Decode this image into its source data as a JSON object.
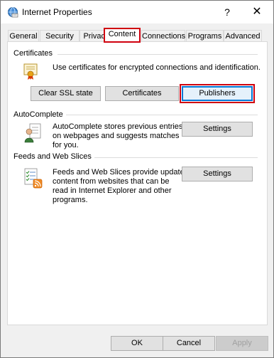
{
  "window": {
    "title": "Internet Properties",
    "help_glyph": "?",
    "close_glyph": "✕"
  },
  "tabs": [
    {
      "label": "General"
    },
    {
      "label": "Security"
    },
    {
      "label": "Privacy"
    },
    {
      "label": "Content",
      "active": true
    },
    {
      "label": "Connections"
    },
    {
      "label": "Programs"
    },
    {
      "label": "Advanced"
    }
  ],
  "certificates": {
    "group_label": "Certificates",
    "description": "Use certificates for encrypted connections and identification.",
    "buttons": {
      "clear_ssl": "Clear SSL state",
      "certificates": "Certificates",
      "publishers": "Publishers"
    }
  },
  "autocomplete": {
    "group_label": "AutoComplete",
    "description_lines": [
      "AutoComplete stores previous entries",
      "on webpages and suggests matches",
      "for you."
    ],
    "settings_label": "Settings"
  },
  "feeds": {
    "group_label": "Feeds and Web Slices",
    "description_lines": [
      "Feeds and Web Slices provide updated",
      "content from websites that can be",
      "read in Internet Explorer and other",
      "programs."
    ],
    "settings_label": "Settings"
  },
  "footer": {
    "ok": "OK",
    "cancel": "Cancel",
    "apply": "Apply"
  },
  "colors": {
    "highlight_red": "#d0000f",
    "focus_blue": "#0078d7"
  },
  "icons": {
    "title": "internet-globe-icon",
    "certificate": "certificate-icon",
    "autocomplete": "user-form-icon",
    "feeds": "rss-feed-icon"
  }
}
